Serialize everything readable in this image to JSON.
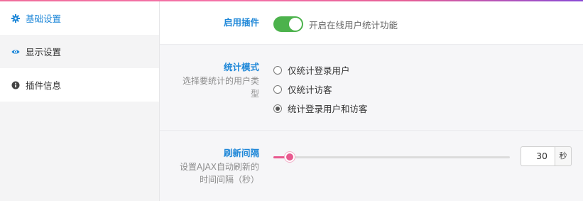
{
  "sidebar": {
    "items": [
      {
        "label": "基础设置",
        "icon": "gear-icon",
        "active": true
      },
      {
        "label": "显示设置",
        "icon": "eye-icon",
        "active": false
      },
      {
        "label": "插件信息",
        "icon": "info-icon",
        "active": false
      }
    ]
  },
  "settings": {
    "enable_plugin": {
      "title": "启用插件",
      "enabled": true,
      "description": "开启在线用户统计功能"
    },
    "stat_mode": {
      "title": "统计模式",
      "description": "选择要统计的用户类型",
      "options": [
        "仅统计登录用户",
        "仅统计访客",
        "统计登录用户和访客"
      ],
      "selected": "统计登录用户和访客"
    },
    "refresh_interval": {
      "title": "刷新间隔",
      "description": "设置AJAX自动刷新的时间间隔（秒）",
      "value": "30",
      "unit": "秒",
      "slider_fraction": 0.07
    }
  },
  "help_icon_glyph": "?",
  "colors": {
    "accent": "#1e87d8",
    "toggle_on": "#4cb24c",
    "slider": "#e8598f",
    "top_gradient_start": "#f06e9c",
    "top_gradient_end": "#8a4bd6"
  }
}
